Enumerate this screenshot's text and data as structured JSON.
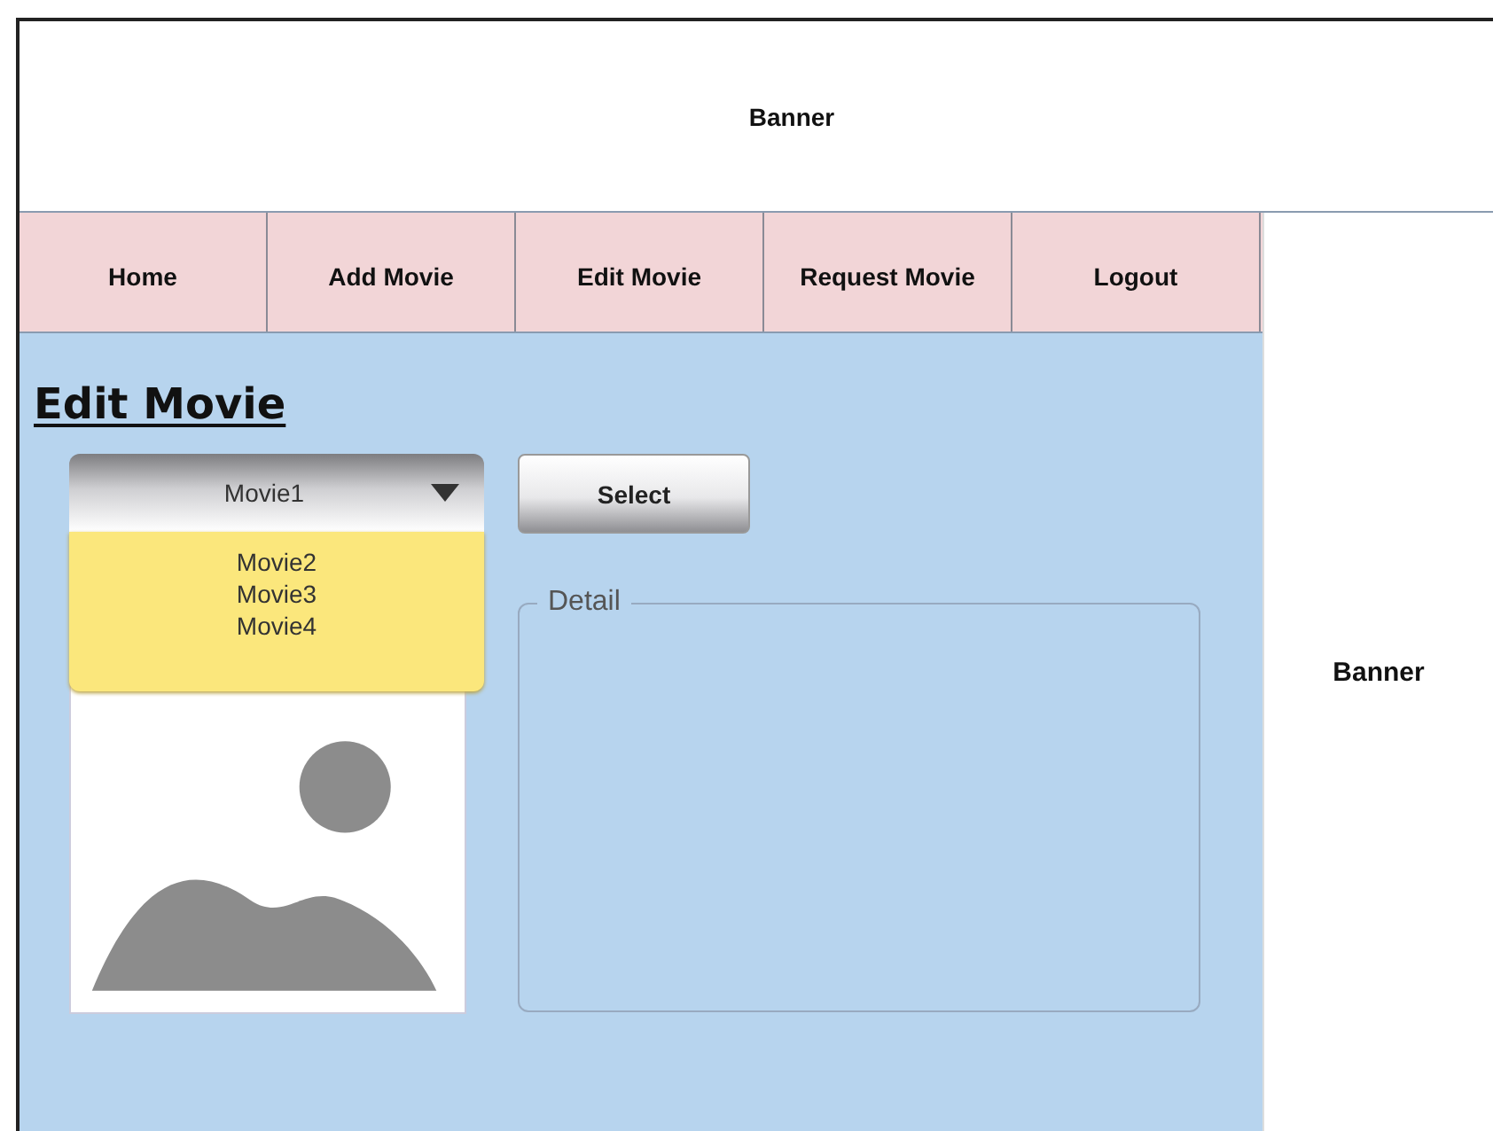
{
  "top_banner": {
    "label": "Banner"
  },
  "nav": {
    "items": [
      {
        "label": "Home"
      },
      {
        "label": "Add Movie"
      },
      {
        "label": "Edit Movie"
      },
      {
        "label": "Request Movie"
      },
      {
        "label": "Logout"
      }
    ]
  },
  "side_banner": {
    "label": "Banner"
  },
  "edit_panel": {
    "title": "Edit Movie",
    "dropdown": {
      "value": "Movie1",
      "expanded": true,
      "options": [
        "Movie2",
        "Movie3",
        "Movie4"
      ]
    },
    "select_button": "Select",
    "detail": {
      "legend": "Detail"
    }
  }
}
